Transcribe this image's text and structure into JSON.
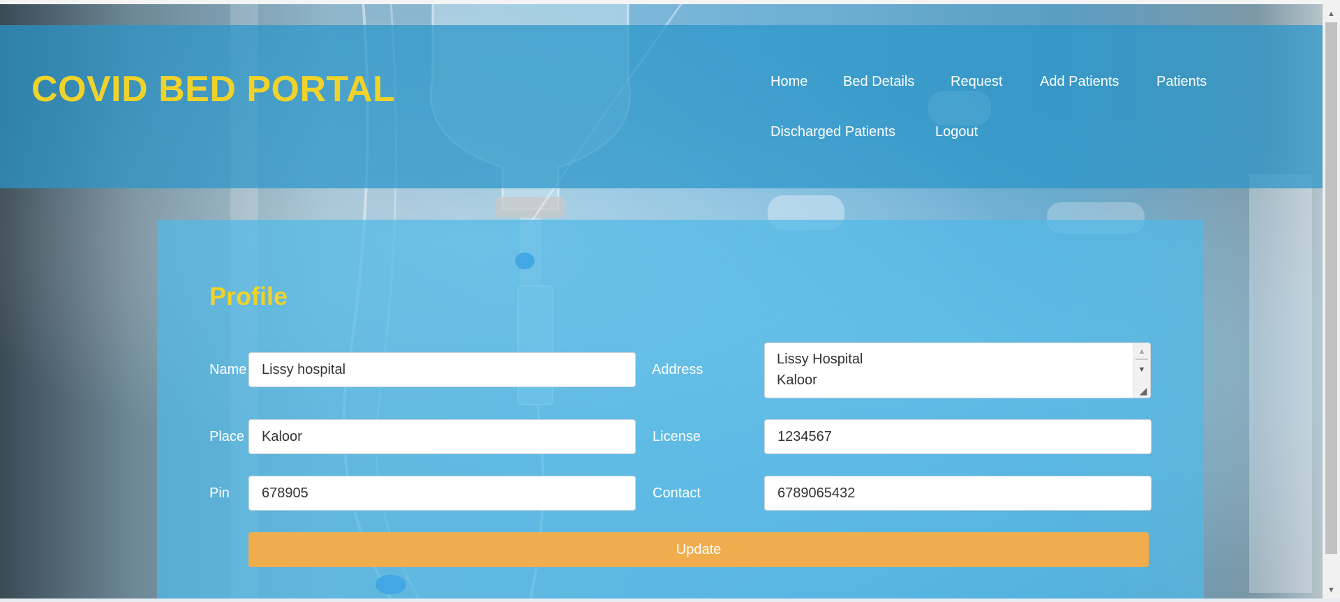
{
  "header": {
    "brand": "COVID BED PORTAL",
    "nav": [
      "Home",
      "Bed Details",
      "Request",
      "Add Patients",
      "Patients",
      "Discharged Patients",
      "Logout"
    ]
  },
  "profile": {
    "title": "Profile",
    "fields": {
      "name": {
        "label": "Name",
        "value": "Lissy hospital"
      },
      "address": {
        "label": "Address",
        "lines": [
          "Lissy Hospital",
          "Kaloor"
        ]
      },
      "place": {
        "label": "Place",
        "value": "Kaloor"
      },
      "license": {
        "label": "License",
        "value": "1234567"
      },
      "pin": {
        "label": "Pin",
        "value": "678905"
      },
      "contact": {
        "label": "Contact",
        "value": "6789065432"
      }
    },
    "update_label": "Update"
  },
  "icons": {
    "scroll_up": "scroll-up-arrow-icon",
    "scroll_down": "scroll-down-arrow-icon",
    "resize": "resize-grip-icon"
  },
  "colors": {
    "brand_yellow": "#f0d32a",
    "header_band": "#2996c9",
    "panel": "#50b9e6",
    "button": "#f0ad4e"
  }
}
